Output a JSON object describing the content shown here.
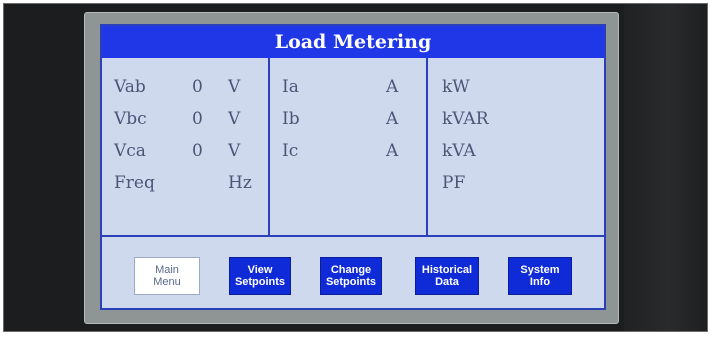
{
  "screen": {
    "title": "Load Metering"
  },
  "voltage_panel": {
    "rows": [
      {
        "label": "Vab",
        "value": "0",
        "unit": "V"
      },
      {
        "label": "Vbc",
        "value": "0",
        "unit": "V"
      },
      {
        "label": "Vca",
        "value": "0",
        "unit": "V"
      },
      {
        "label": "Freq",
        "value": "",
        "unit": "Hz"
      }
    ]
  },
  "current_panel": {
    "rows": [
      {
        "label": "Ia",
        "value": "",
        "unit": "A"
      },
      {
        "label": "Ib",
        "value": "",
        "unit": "A"
      },
      {
        "label": "Ic",
        "value": "",
        "unit": "A"
      }
    ]
  },
  "power_panel": {
    "rows": [
      {
        "label": "kW",
        "value": ""
      },
      {
        "label": "kVAR",
        "value": ""
      },
      {
        "label": "kVA",
        "value": ""
      },
      {
        "label": "PF",
        "value": ""
      }
    ]
  },
  "nav_buttons": [
    {
      "label": "Main\nMenu"
    },
    {
      "label": "View\nSetpoints"
    },
    {
      "label": "Change\nSetpoints"
    },
    {
      "label": "Historical\nData"
    },
    {
      "label": "System\nInfo"
    }
  ],
  "colors": {
    "title_bar": "#1f37e6",
    "screen_bg": "#cfd9ee",
    "button_primary": "#0f2bd8",
    "text": "#4d5577"
  }
}
